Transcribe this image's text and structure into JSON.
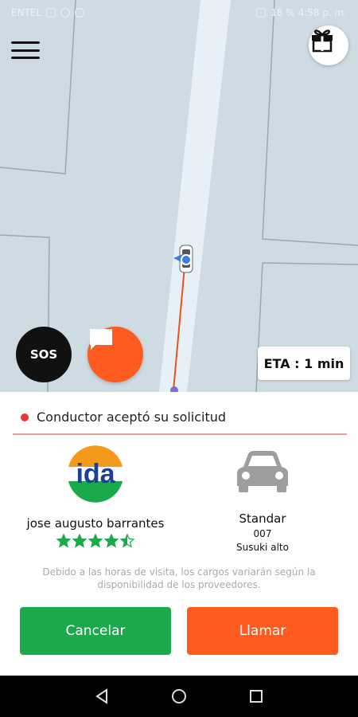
{
  "status_bar": {
    "carrier": "ENTEL",
    "right_text": "18 % 4:58 p. m."
  },
  "map": {
    "eta_label": "ETA : 1 min",
    "sos_label": "SOS"
  },
  "card": {
    "status_message": "Conductor aceptó su solicitud",
    "driver": {
      "name": "jose augusto barrantes",
      "logo_text": "ida",
      "rating": 4.5
    },
    "vehicle": {
      "type": "Standar",
      "number": "007",
      "model": "Susuki alto"
    },
    "notice": "Debido a las horas de visita, los cargos variarán según la disponibilidad de los proveedores.",
    "cancel_label": "Cancelar",
    "call_label": "Llamar"
  },
  "colors": {
    "accent_orange": "#ff5a1f",
    "accent_green": "#1aaa4b",
    "status_red": "#e53935"
  }
}
